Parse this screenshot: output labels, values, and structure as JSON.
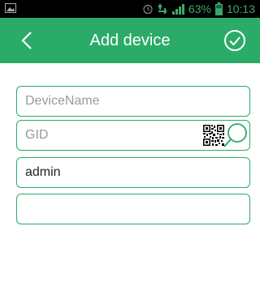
{
  "status_bar": {
    "battery_percent": "63%",
    "time": "10:13",
    "icons": [
      "image-icon",
      "alarm-icon",
      "data-transfer-icon",
      "signal-icon",
      "battery-icon"
    ]
  },
  "header": {
    "title": "Add device",
    "back_icon": "chevron-left-icon",
    "confirm_icon": "check-circle-icon",
    "background_color": "#2bab68"
  },
  "form": {
    "device_name": {
      "value": "",
      "placeholder": "DeviceName"
    },
    "gid": {
      "value": "",
      "placeholder": "GID",
      "icons": [
        "qr-code-icon",
        "search-icon"
      ]
    },
    "username": {
      "value": "admin",
      "placeholder": ""
    },
    "password": {
      "value": "",
      "placeholder": ""
    }
  },
  "colors": {
    "accent": "#2bab68",
    "status_bar": "#000000",
    "status_text": "#3aa86a"
  }
}
